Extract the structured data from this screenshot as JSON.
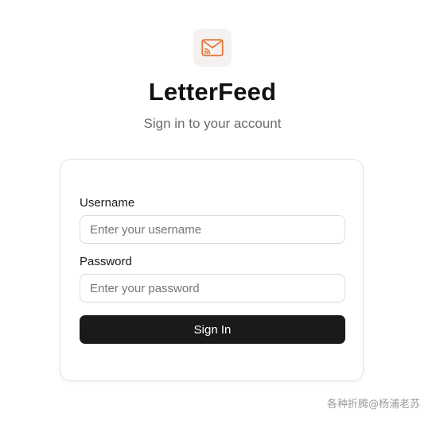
{
  "app": {
    "name": "LetterFeed",
    "subtitle": "Sign in to your account",
    "logo_icon": "mail-rss-icon",
    "accent_color": "#e07a3f"
  },
  "login_form": {
    "username_label": "Username",
    "username_placeholder": "Enter your username",
    "username_value": "",
    "password_label": "Password",
    "password_placeholder": "Enter your password",
    "password_value": "",
    "submit_label": "Sign In"
  },
  "watermark": {
    "text": "各种折腾@杨浦老苏"
  }
}
